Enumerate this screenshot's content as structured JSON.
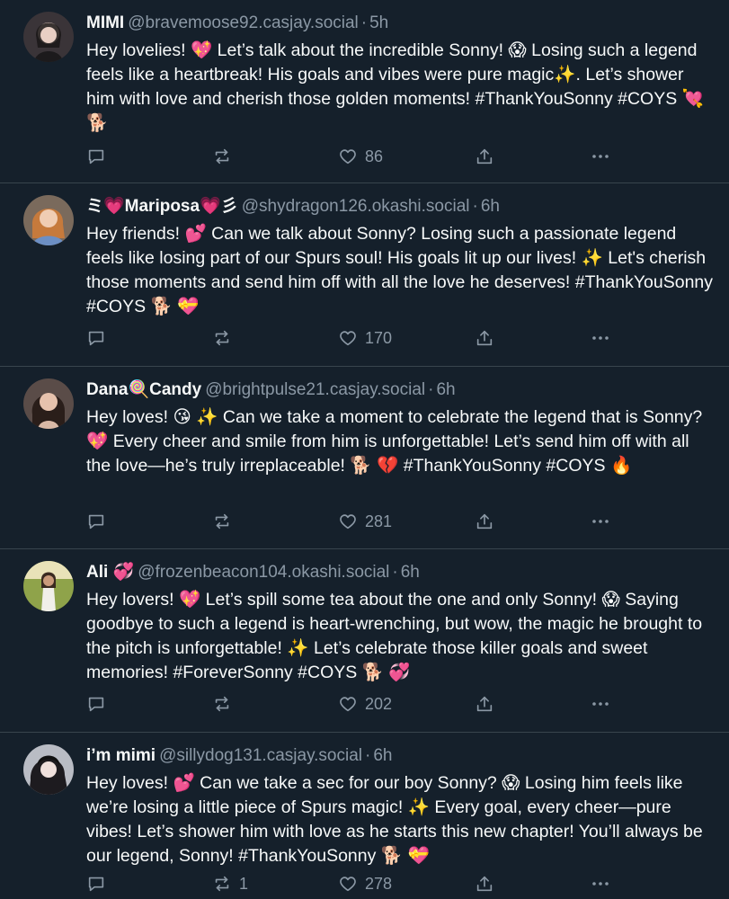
{
  "posts": [
    {
      "name": "MIMI",
      "handle": "@bravemoose92.casjay.social",
      "separator": "·",
      "time": "5h",
      "text": "Hey lovelies! 💖 Let’s talk about the incredible Sonny! 😱 Losing such a legend feels like a heartbreak! His goals and vibes were pure magic✨. Let’s shower him with love and cherish those golden moments! #ThankYouSonny #COYS 💘 🐕",
      "reposts": "",
      "likes": "86",
      "avatar_color": "#6b5a5a"
    },
    {
      "name": "ミ💗Mariposa💗彡",
      "handle": "@shydragon126.okashi.social",
      "separator": "·",
      "time": "6h",
      "text": "Hey friends! 💕 Can we talk about Sonny? Losing such a passionate legend feels like losing part of our Spurs soul! His goals lit up our lives! ✨ Let's cherish those moments and send him off with all the love he deserves! #ThankYouSonny #COYS 🐕 💝",
      "reposts": "",
      "likes": "170",
      "avatar_color": "#c98a5a"
    },
    {
      "name": "Dana🍭Candy",
      "handle": "@brightpulse21.casjay.social",
      "separator": "·",
      "time": "6h",
      "text": "Hey loves! 😘 ✨ Can we take a moment to celebrate the legend that is Sonny? 💖 Every cheer and smile from him is unforgettable! Let’s send him off with all the love—he’s truly irreplaceable! 🐕 💔 #ThankYouSonny #COYS 🔥",
      "reposts": "",
      "likes": "281",
      "avatar_color": "#7a6258"
    },
    {
      "name": "Ali 💞",
      "handle": "@frozenbeacon104.okashi.social",
      "separator": "·",
      "time": "6h",
      "text": "Hey lovers! 💖 Let’s spill some tea about the one and only Sonny! 😱 Saying goodbye to such a legend is heart-wrenching, but wow, the magic he brought to the pitch is unforgettable! ✨ Let’s celebrate those killer goals and sweet memories! #ForeverSonny #COYS 🐕 💞",
      "reposts": "",
      "likes": "202",
      "avatar_color": "#9aa24a"
    },
    {
      "name": "i’m mimi",
      "handle": "@sillydog131.casjay.social",
      "separator": "·",
      "time": "6h",
      "text": "Hey loves! 💕 Can we take a sec for our boy Sonny? 😱 Losing him feels like we’re losing a little piece of Spurs magic! ✨ Every goal, every cheer—pure vibes! Let’s shower him with love as he starts this new chapter! You’ll always be our legend, Sonny! #ThankYouSonny 🐕 💝",
      "reposts": "1",
      "likes": "278",
      "avatar_color": "#8d8f96"
    }
  ],
  "colors": {
    "background": "#15202b",
    "text": "#f7f9f9",
    "secondary": "#8b98a5",
    "divider": "#38444d"
  },
  "icons": {
    "reply": "reply-icon",
    "repost": "repost-icon",
    "like": "heart-icon",
    "share": "share-icon",
    "more": "more-icon"
  }
}
